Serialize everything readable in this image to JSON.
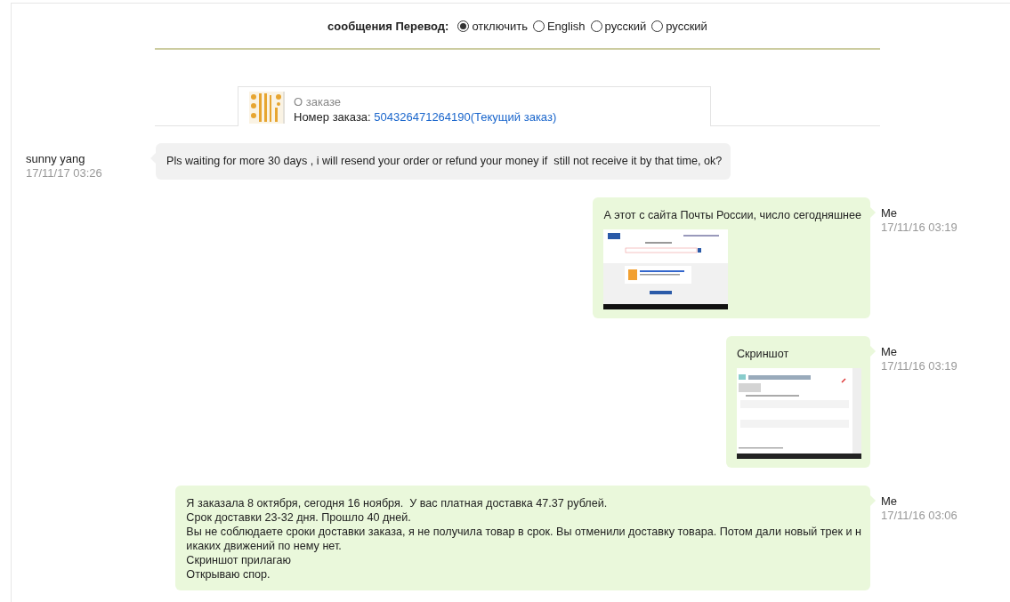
{
  "translation": {
    "label": "сообщения Перевод:",
    "options": [
      {
        "label": "отключить",
        "selected": true
      },
      {
        "label": "English",
        "selected": false
      },
      {
        "label": "русский",
        "selected": false
      },
      {
        "label": "русский",
        "selected": false
      }
    ]
  },
  "order": {
    "title": "О заказе",
    "number_label": "Номер заказа:",
    "number_link": "504326471264190(Текущий заказ)"
  },
  "messages": [
    {
      "kind": "incoming",
      "sender": "sunny yang",
      "time": "17/11/17 03:26",
      "text": "Pls waiting for more 30 days , i will resend your order or refund your money if  still not receive it by that time, ok?"
    },
    {
      "kind": "outgoing",
      "sender": "Me",
      "time": "17/11/16 03:19",
      "text": "А этот с сайта Почты России, число сегодняшнее",
      "attachment": {
        "kind": "tracking-page"
      }
    },
    {
      "kind": "outgoing",
      "sender": "Me",
      "time": "17/11/16 03:19",
      "text": "Скриншот",
      "attachment": {
        "kind": "shipment-page"
      }
    },
    {
      "kind": "outgoing",
      "sender": "Me",
      "time": "17/11/16 03:06",
      "text": "Я заказала 8 октября, сегодня 16 ноября.  У вас платная доставка 47.37 рублей.\nСрок доставки 23-32 дня. Прошло 40 дней.\nВы не соблюдаете сроки доставки заказа, я не получила товар в срок. Вы отменили доставку товара. Потом дали новый трек и н\nикаких движений по нему нет.\nСкриншот прилагаю\nОткрываю спор."
    }
  ]
}
